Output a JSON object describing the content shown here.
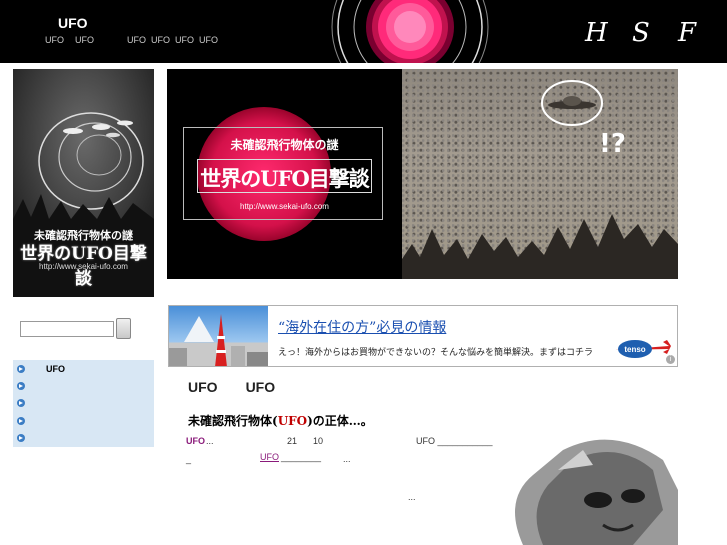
{
  "header": {
    "title": "UFO",
    "nav": [
      "UFO",
      "UFO",
      "UFO",
      "UFO",
      "UFO",
      "UFO"
    ],
    "letters": [
      "H",
      "S",
      "F"
    ]
  },
  "left_banner": {
    "title_small": "未確認飛行物体の謎",
    "title_large": "世界のUFO目撃談",
    "url": "http://www.sekai-ufo.com"
  },
  "search": {
    "value": ""
  },
  "side_menu": {
    "items": [
      {
        "label": "UFO"
      },
      {
        "label": ""
      },
      {
        "label": ""
      },
      {
        "label": ""
      },
      {
        "label": ""
      }
    ]
  },
  "main_banner": {
    "title_small": "未確認飛行物体の謎",
    "title_large": "世界のUFO目撃談",
    "url": "http://www.sekai-ufo.com",
    "photo_mark": "!?"
  },
  "ad": {
    "headline": "“海外在住の方”必見の情報",
    "text": "えっ！海外からはお買物ができないの？そんな悩みを簡単解決。まずはコチラ",
    "logo": "tenso",
    "info": "i"
  },
  "article": {
    "header_left": "UFO",
    "header_right": "UFO",
    "heading_pre": "未確認飛行物体(",
    "heading_ufo": "UFO",
    "heading_post": ")の正体…。",
    "line1_link": "UFO",
    "line1_dots": "...",
    "line1_num1": "21",
    "line1_num2": "10",
    "line1_right": "UFO ___________",
    "line2_under": "_",
    "line2_link": "UFO",
    "line2_blank": "________",
    "line2_dots": "...",
    "line3_dots": "..."
  }
}
